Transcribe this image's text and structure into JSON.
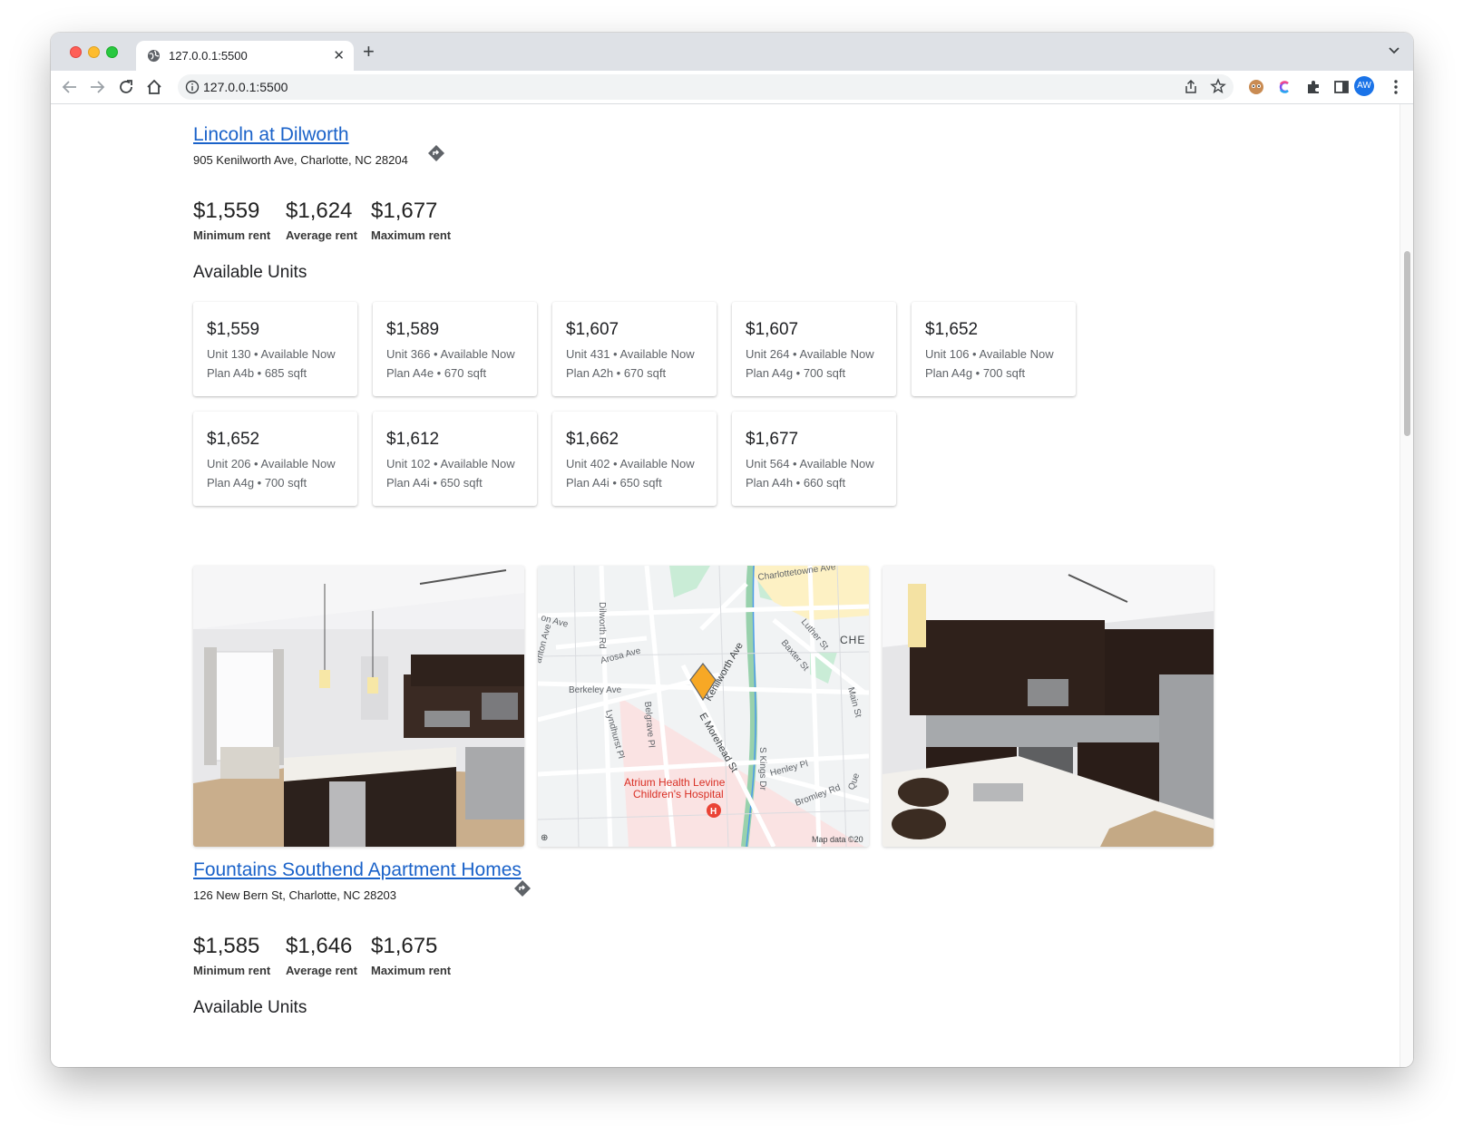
{
  "browser": {
    "tab_title": "127.0.0.1:5500",
    "url": "127.0.0.1:5500",
    "avatar_initials": "AW"
  },
  "properties": [
    {
      "name": "Lincoln at Dilworth",
      "address": "905 Kenilworth Ave, Charlotte, NC 28204",
      "stats": [
        {
          "value": "$1,559",
          "label": "Minimum rent"
        },
        {
          "value": "$1,624",
          "label": "Average rent"
        },
        {
          "value": "$1,677",
          "label": "Maximum rent"
        }
      ],
      "units_heading": "Available Units",
      "units": [
        {
          "price": "$1,559",
          "unit": "Unit 130 • Available Now",
          "plan": "Plan A4b • 685 sqft"
        },
        {
          "price": "$1,589",
          "unit": "Unit 366 • Available Now",
          "plan": "Plan A4e • 670 sqft"
        },
        {
          "price": "$1,607",
          "unit": "Unit 431 • Available Now",
          "plan": "Plan A2h • 670 sqft"
        },
        {
          "price": "$1,607",
          "unit": "Unit 264 • Available Now",
          "plan": "Plan A4g • 700 sqft"
        },
        {
          "price": "$1,652",
          "unit": "Unit 106 • Available Now",
          "plan": "Plan A4g • 700 sqft"
        },
        {
          "price": "$1,652",
          "unit": "Unit 206 • Available Now",
          "plan": "Plan A4g • 700 sqft"
        },
        {
          "price": "$1,612",
          "unit": "Unit 102 • Available Now",
          "plan": "Plan A4i • 650 sqft"
        },
        {
          "price": "$1,662",
          "unit": "Unit 402 • Available Now",
          "plan": "Plan A4i • 650 sqft"
        },
        {
          "price": "$1,677",
          "unit": "Unit 564 • Available Now",
          "plan": "Plan A4h • 660 sqft"
        }
      ],
      "map": {
        "labels": [
          "Charlottetowne Ave",
          "Dilworth Rd",
          "Arosa Ave",
          "Berkeley Ave",
          "Kenilworth Ave",
          "E Morehead St",
          "Belgrave Pl",
          "Lyndhurst Pl",
          "S Kings Dr",
          "Baxter St",
          "Luther St",
          "Main St",
          "Henley Pl",
          "Bromley Rd",
          "CHE",
          "Que",
          "Atrium Health Levine Children's Hospital",
          "Map data ©20"
        ]
      }
    },
    {
      "name": "Fountains Southend Apartment Homes",
      "address": "126 New Bern St, Charlotte, NC 28203",
      "stats": [
        {
          "value": "$1,585",
          "label": "Minimum rent"
        },
        {
          "value": "$1,646",
          "label": "Average rent"
        },
        {
          "value": "$1,675",
          "label": "Maximum rent"
        }
      ],
      "units_heading": "Available Units"
    }
  ]
}
